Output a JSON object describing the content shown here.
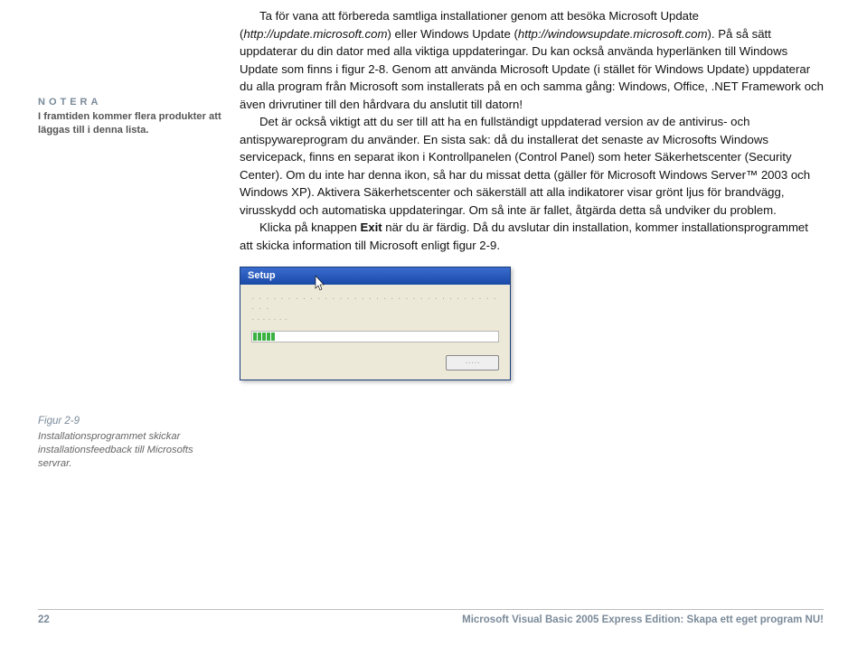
{
  "sidebar_note": {
    "title": "NOTERA",
    "text": "I framtiden kommer flera produkter att läggas till i denna lista."
  },
  "body": {
    "p1_a": "Ta för vana att förbereda samtliga installationer genom att besöka Microsoft Update (",
    "p1_link1": "http://update.microsoft.com",
    "p1_b": ") eller Windows Update (",
    "p1_link2": "http://windowsupdate.microsoft.com",
    "p1_c": "). På så sätt uppdaterar du din dator med alla viktiga uppdateringar. Du kan också använda hyperlänken till Windows Update som finns i figur 2-8. Genom att använda Microsoft Update (i stället för Windows Update) uppdaterar du alla program från Microsoft som installerats på en och samma gång: Windows, Office, .NET Framework och även drivrutiner till den hårdvara du anslutit till datorn!",
    "p2": "Det är också viktigt att du ser till att ha en fullständigt uppdaterad version av de antivirus- och antispywareprogram du använder. En sista sak: då du installerat det senaste av Microsofts Windows servicepack, finns en separat ikon i Kontrollpanelen (Control Panel) som heter Säkerhetscenter (Security Center). Om du inte har denna ikon, så har du missat detta (gäller för Microsoft Windows Server™ 2003 och Windows XP). Aktivera Säkerhetscenter och säkerställ att alla indikatorer visar grönt ljus för brandvägg, virusskydd och automatiska uppdateringar. Om så inte är fallet, åtgärda detta så undviker du problem.",
    "p3_a": "Klicka på knappen ",
    "p3_bold": "Exit",
    "p3_b": " när du är färdig. Då du avslutar din installation, kommer installationsprogrammet att skicka information till Microsoft enligt figur 2-9."
  },
  "dialog": {
    "title": "Setup",
    "line1": "· · · · · · · · · · · · · · · · · · · · · · · · · · · · · · · · · · · · ·",
    "line2": "· · · · · · ·",
    "button": "·····"
  },
  "figure": {
    "title": "Figur 2-9",
    "text": "Installationsprogrammet skickar installationsfeedback till Microsofts servrar."
  },
  "footer": {
    "page": "22",
    "title": "Microsoft Visual Basic 2005 Express Edition: Skapa ett eget program NU!"
  }
}
